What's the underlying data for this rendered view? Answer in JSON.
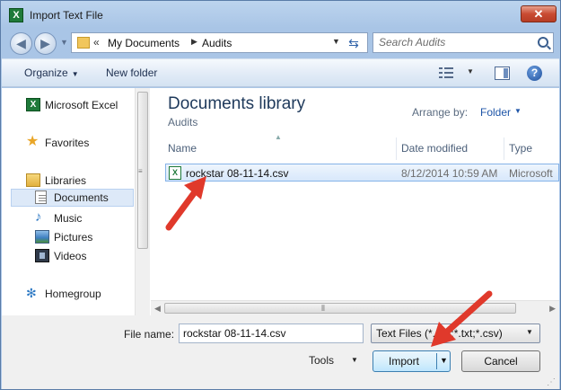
{
  "window": {
    "title": "Import Text File",
    "close_glyph": "✕",
    "app_icon_letter": "X"
  },
  "address": {
    "chevron": "«",
    "crumbs": [
      "My Documents",
      "Audits"
    ],
    "search_placeholder": "Search Audits"
  },
  "toolbar": {
    "organize": "Organize",
    "new_folder": "New folder",
    "help": "?"
  },
  "nav": {
    "items": [
      {
        "label": "Microsoft Excel",
        "icon": "excel-icon"
      },
      {
        "label": "Favorites",
        "icon": "star-icon"
      },
      {
        "label": "Libraries",
        "icon": "library-icon"
      },
      {
        "label": "Documents",
        "icon": "document-icon"
      },
      {
        "label": "Music",
        "icon": "music-icon"
      },
      {
        "label": "Pictures",
        "icon": "pictures-icon"
      },
      {
        "label": "Videos",
        "icon": "videos-icon"
      },
      {
        "label": "Homegroup",
        "icon": "homegroup-icon"
      }
    ]
  },
  "library": {
    "title": "Documents library",
    "subtitle": "Audits",
    "arrange_label": "Arrange by:",
    "arrange_value": "Folder"
  },
  "columns": {
    "name": "Name",
    "date": "Date modified",
    "type": "Type"
  },
  "files": [
    {
      "name": "rockstar 08-11-14.csv",
      "date": "8/12/2014 10:59 AM",
      "type": "Microsoft",
      "icon_letter": "X"
    }
  ],
  "footer": {
    "file_name_label": "File name:",
    "file_name_value": "rockstar 08-11-14.csv",
    "filter": "Text Files (*.prn;*.txt;*.csv)",
    "tools": "Tools",
    "import": "Import",
    "cancel": "Cancel"
  },
  "colors": {
    "annotation_arrow": "#e0392b",
    "accent_title": "#1e395b"
  }
}
